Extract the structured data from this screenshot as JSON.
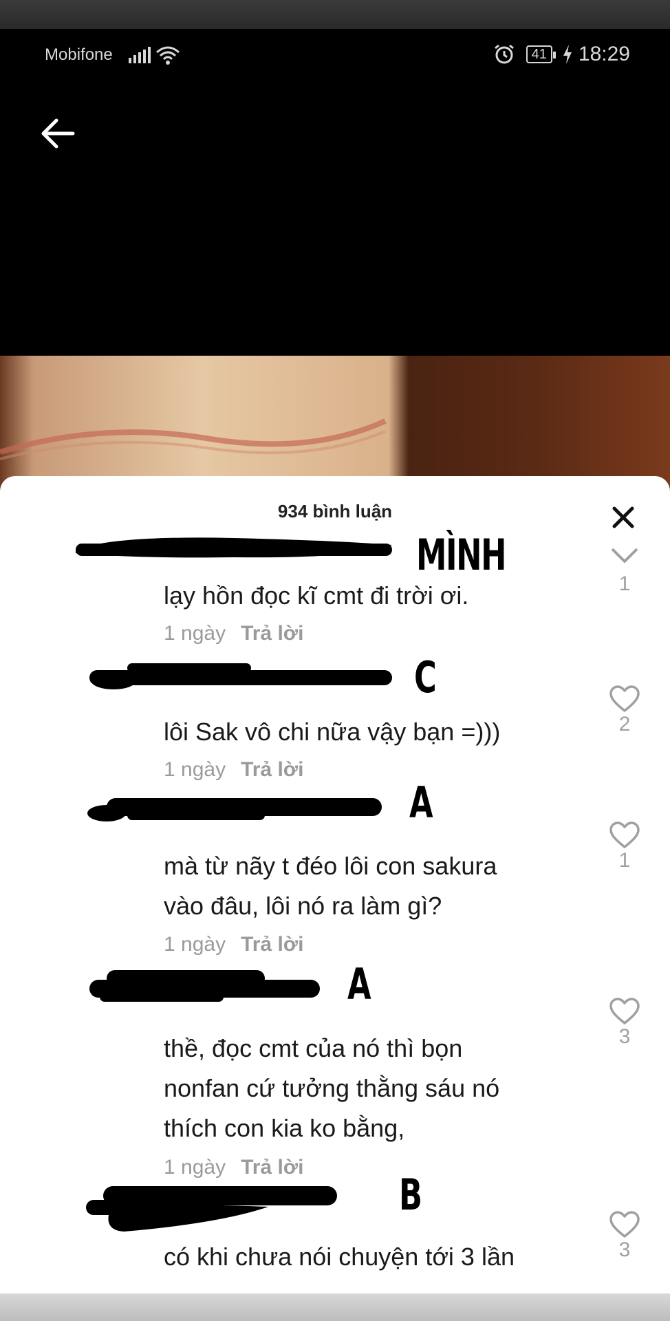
{
  "status_bar": {
    "carrier": "Mobifone",
    "battery_level": "41",
    "time": "18:29"
  },
  "sheet": {
    "comment_count_label": "934 bình luận"
  },
  "comments": [
    {
      "annotation": "MÌNH",
      "text_lines": [
        "lạy hồn đọc kĩ cmt đi trời ơi."
      ],
      "time": "1 ngày",
      "reply_label": "Trả lời",
      "like_count": "1"
    },
    {
      "annotation": "C",
      "text_lines": [
        "lôi Sak vô chi nữa vậy bạn =)))"
      ],
      "time": "1 ngày",
      "reply_label": "Trả lời",
      "like_count": "2"
    },
    {
      "annotation": "A",
      "text_lines": [
        "mà từ nãy t đéo lôi con sakura",
        "vào đâu, lôi nó ra làm gì?"
      ],
      "time": "1 ngày",
      "reply_label": "Trả lời",
      "like_count": "1"
    },
    {
      "annotation": "A",
      "text_lines": [
        "thề, đọc cmt của nó thì bọn",
        "nonfan cứ tưởng thằng sáu nó",
        "thích con kia ko bằng,"
      ],
      "time": "1 ngày",
      "reply_label": "Trả lời",
      "like_count": "3"
    },
    {
      "annotation": "B",
      "text_lines": [
        "có khi chưa nói chuyện tới 3 lần"
      ],
      "time": "",
      "reply_label": "",
      "like_count": "3"
    }
  ],
  "colors": {
    "sheet_background": "#ffffff",
    "text_primary": "#1a1a1a",
    "text_secondary": "#9a9a9a",
    "redaction": "#000000"
  },
  "icons": [
    "back-arrow-icon",
    "close-icon",
    "heart-icon",
    "alarm-icon",
    "wifi-icon",
    "signal-icon",
    "charging-bolt-icon"
  ]
}
